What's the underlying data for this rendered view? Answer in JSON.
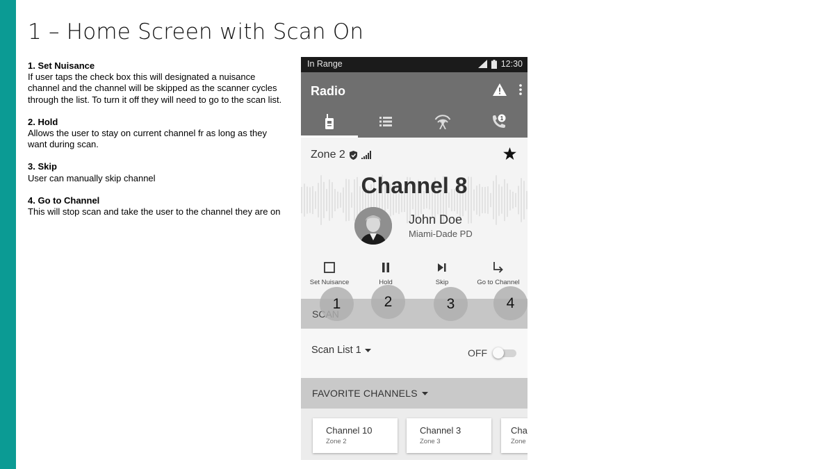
{
  "slide": {
    "title": "1 – Home Screen with Scan On",
    "accent_color": "#0b9b94"
  },
  "notes": [
    {
      "heading": "1. Set Nuisance",
      "body": "If user taps the check box this will designated a nuisance channel and the channel will be skipped as the scanner cycles through the list. To turn it off they will need to go to the scan list."
    },
    {
      "heading": "2. Hold",
      "body": "Allows the user to stay on current channel fr as long as they want during scan."
    },
    {
      "heading": "3. Skip",
      "body": "User can manually skip channel"
    },
    {
      "heading": "4.  Go to Channel",
      "body": "This will stop scan and take the user to the channel they are on"
    }
  ],
  "phone": {
    "status": {
      "left": "In Range",
      "time": "12:30"
    },
    "appbar": {
      "title": "Radio",
      "alert_icon": "warning-icon",
      "menu_icon": "more-vert-icon"
    },
    "tabs": [
      {
        "icon": "walkie-talkie-icon",
        "active": true
      },
      {
        "icon": "list-icon",
        "active": false
      },
      {
        "icon": "broadcast-tower-icon",
        "active": false
      },
      {
        "icon": "phone-call-icon",
        "active": false,
        "badge": "1"
      }
    ],
    "zone": {
      "label": "Zone 2",
      "favorite": true
    },
    "channel": {
      "name": "Channel 8"
    },
    "caller": {
      "name": "John Doe",
      "org": "Miami-Dade PD"
    },
    "actions": [
      {
        "icon": "checkbox-icon",
        "label": "Set Nuisance"
      },
      {
        "icon": "pause-icon",
        "label": "Hold"
      },
      {
        "icon": "skip-next-icon",
        "label": "Skip"
      },
      {
        "icon": "arrow-turn-icon",
        "label": "Go to Channel"
      }
    ],
    "scan": {
      "header": "SCAN",
      "list": "Scan List 1",
      "state": "OFF",
      "enabled": false
    },
    "favorites": {
      "header": "FAVORITE CHANNELS",
      "items": [
        {
          "name": "Channel 10",
          "zone": "Zone 2"
        },
        {
          "name": "Channel 3",
          "zone": "Zone 3"
        },
        {
          "name": "Cha",
          "zone": "Zone"
        }
      ]
    }
  },
  "markers": [
    "1",
    "2",
    "3",
    "4"
  ]
}
